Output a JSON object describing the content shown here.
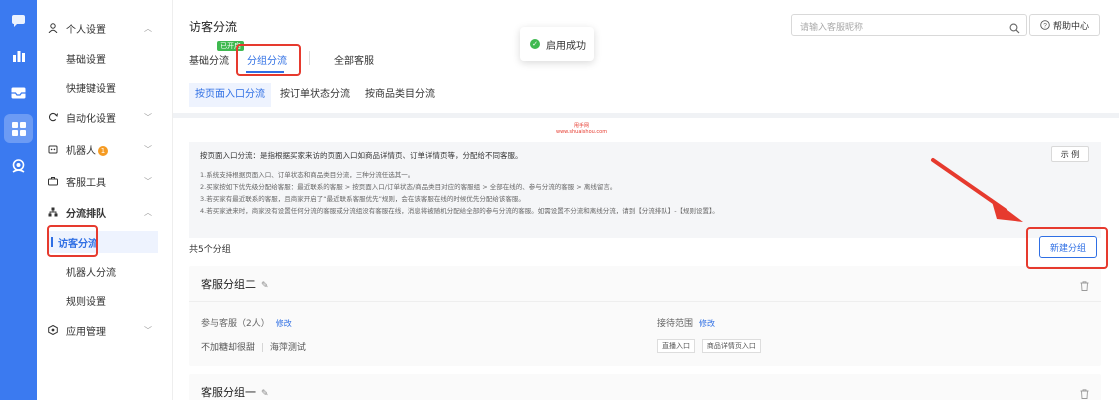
{
  "header": {
    "title": "访客分流",
    "search_placeholder": "请输入客服昵称",
    "help_label": "帮助中心",
    "toast_text": "启用成功",
    "tabs": [
      {
        "label": "基础分流"
      },
      {
        "label": "分组分流",
        "tag": "已开启"
      },
      {
        "label": "全部客服"
      }
    ],
    "subtabs": [
      "按页面入口分流",
      "按订单状态分流",
      "按商品类目分流"
    ]
  },
  "sidebar": {
    "items": [
      {
        "label": "个人设置",
        "icon": "user-icon"
      },
      {
        "label": "基础设置"
      },
      {
        "label": "快捷键设置"
      },
      {
        "label": "自动化设置",
        "icon": "sync-icon"
      },
      {
        "label": "机器人",
        "icon": "robot-icon",
        "badge": "1"
      },
      {
        "label": "客服工具",
        "icon": "toolbox-icon"
      },
      {
        "label": "分流排队",
        "icon": "hierarchy-icon"
      },
      {
        "label": "访客分流"
      },
      {
        "label": "机器人分流"
      },
      {
        "label": "规则设置"
      },
      {
        "label": "应用管理",
        "icon": "app-icon"
      }
    ]
  },
  "notice": {
    "head": "按页面入口分流：是指根据买家来访的页面入口如商品详情页、订单详情页等，分配给不同客服。",
    "lines": [
      "1.系统支持根据页面入口、订单状态和商品类目分流，三种分流任选其一。",
      "2.买家按如下优先级分配给客服：最近联系的客服 > 按页面入口/订单状态/商品类目对应的客服组 > 全部在线的、参与分流的客服 > 离线留言。",
      "3.若买家有最近联系的客服，且商家开启了“最近联系客服优先”规则，会在该客服在线的时候优先分配给该客服。",
      "4.若买家进来时，商家没有设置任何分流的客服或分流组没有客服在线，消息将被随机分配给全部的参与分流的客服。如需设置不分流和离线分流，请到【分流排队】-【规则设置】。"
    ],
    "example_label": "示 例",
    "watermark_1": "甩手网",
    "watermark_2": "www.shuaishou.com"
  },
  "groups": {
    "count_label": "共5个分组",
    "new_button": "新建分组",
    "cards": [
      {
        "name": "客服分组二",
        "members_label": "参与客服（2人）",
        "edit_label": "修改",
        "scope_label": "接待范围",
        "scope_edit": "修改",
        "members": [
          "不加糖却很甜",
          "海萍测试"
        ],
        "scopes": [
          "直播入口",
          "商品详情页入口"
        ]
      },
      {
        "name": "客服分组一"
      }
    ]
  },
  "colors": {
    "primary": "#2f6fe4",
    "iconbar": "#3b7af0",
    "highlight": "#e63a2e",
    "success": "#3fb950"
  }
}
